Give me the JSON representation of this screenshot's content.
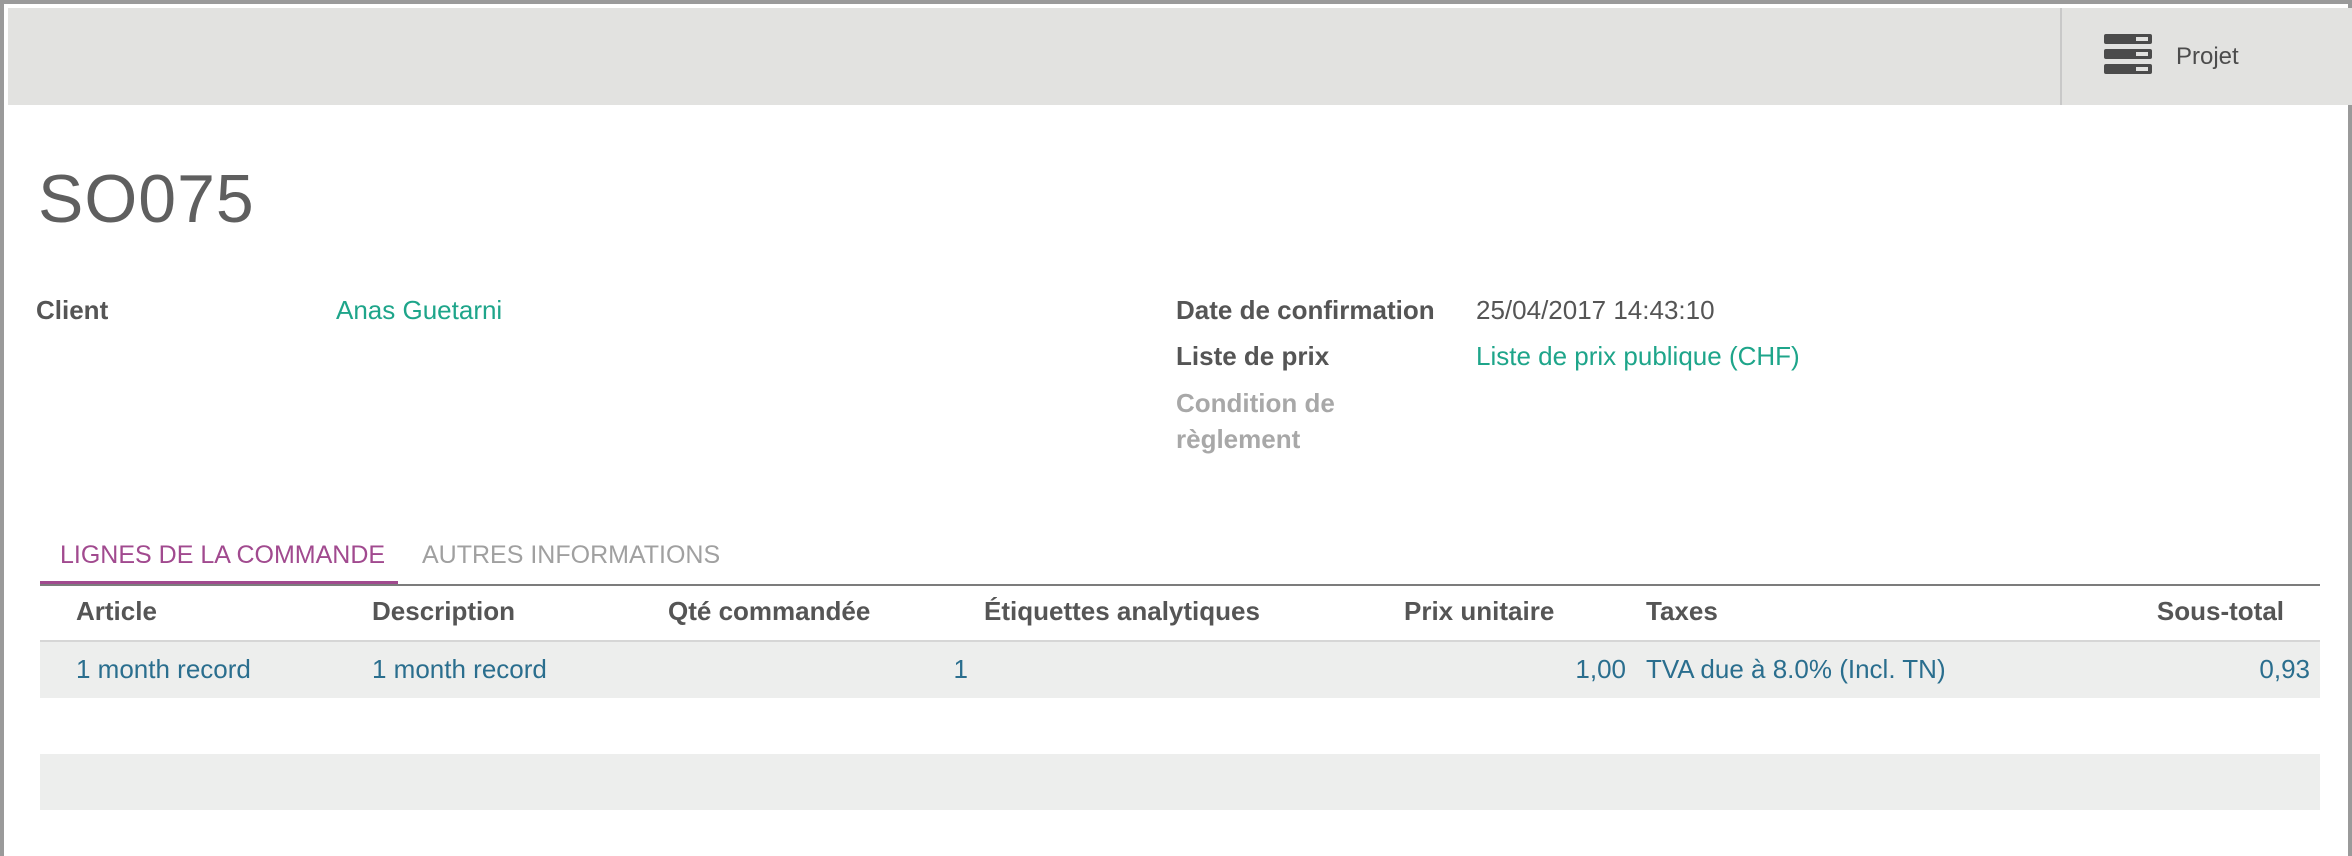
{
  "header": {
    "smart_button_label": "Projet",
    "smart_button_icon": "server-icon"
  },
  "record": {
    "title": "SO075"
  },
  "fields": {
    "client_label": "Client",
    "client_value": "Anas Guetarni",
    "confirmation_date_label": "Date de confirmation",
    "confirmation_date_value": "25/04/2017 14:43:10",
    "pricelist_label": "Liste de prix",
    "pricelist_value": "Liste de prix publique (CHF)",
    "payment_terms_label_line1": "Condition de",
    "payment_terms_label_line2": "règlement"
  },
  "tabs": [
    {
      "label": "LIGNES DE LA COMMANDE",
      "active": true
    },
    {
      "label": "AUTRES INFORMATIONS",
      "active": false
    }
  ],
  "table": {
    "columns": [
      "Article",
      "Description",
      "Qté commandée",
      "Étiquettes analytiques",
      "Prix unitaire",
      "Taxes",
      "Sous-total"
    ],
    "rows": [
      {
        "article": "1 month record",
        "description": "1 month record",
        "quantity": "1",
        "analytic_tags": "",
        "unit_price": "1,00",
        "taxes": "TVA due à 8.0% (Incl. TN)",
        "subtotal": "0,93"
      }
    ]
  },
  "colors": {
    "link": "#1ea58a",
    "active_tab": "#a14a8f",
    "table_text": "#2a6e8e",
    "topbar": "#e2e2e0"
  }
}
